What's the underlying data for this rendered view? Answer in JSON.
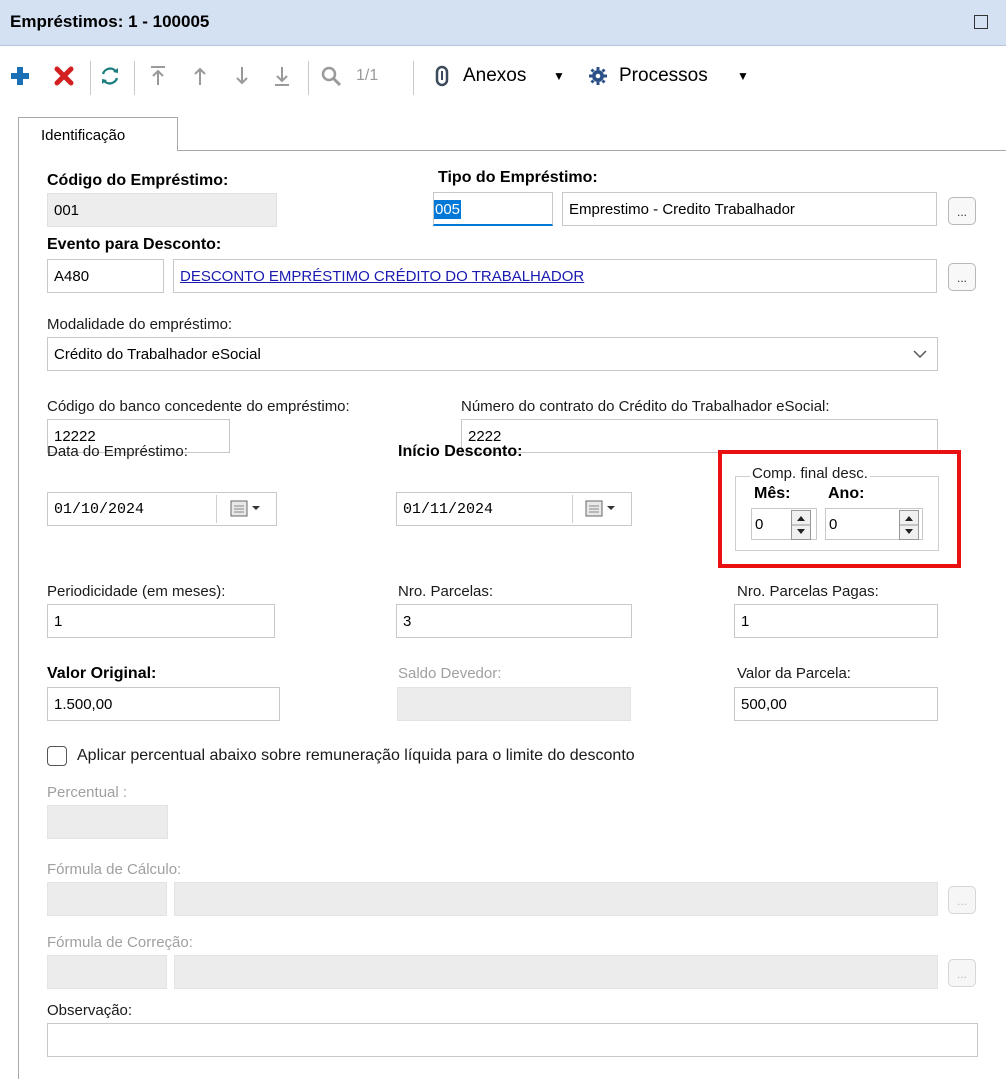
{
  "window": {
    "title": "Empréstimos: 1 - 100005"
  },
  "toolbar": {
    "page_indicator": "1/1",
    "anexos_label": "Anexos",
    "processos_label": "Processos"
  },
  "tabs": [
    {
      "label": "Identificação"
    }
  ],
  "form": {
    "codigo_emprestimo": {
      "label": "Código do Empréstimo:",
      "value": "001"
    },
    "tipo_emprestimo": {
      "label": "Tipo do Empréstimo:",
      "code": "005",
      "description": "Emprestimo - Credito Trabalhador"
    },
    "evento_desconto": {
      "label": "Evento para Desconto:",
      "code": "A480",
      "description": "DESCONTO EMPRÉSTIMO CRÉDITO DO TRABALHADOR"
    },
    "modalidade": {
      "label": "Modalidade do empréstimo:",
      "value": "Crédito do Trabalhador eSocial"
    },
    "codigo_banco": {
      "label": "Código do banco concedente do empréstimo:",
      "value": "12222"
    },
    "numero_contrato": {
      "label": "Número do contrato do Crédito do Trabalhador eSocial:",
      "value": "2222"
    },
    "data_emprestimo": {
      "label": "Data do Empréstimo:",
      "value": "01/10/2024"
    },
    "inicio_desconto": {
      "label": "Início Desconto:",
      "value": "01/11/2024"
    },
    "comp_final": {
      "label": "Comp. final desc.",
      "mes_label": "Mês:",
      "ano_label": "Ano:",
      "mes_value": "0",
      "ano_value": "0"
    },
    "periodicidade": {
      "label": "Periodicidade (em meses):",
      "value": "1"
    },
    "nro_parcelas": {
      "label": "Nro. Parcelas:",
      "value": "3"
    },
    "nro_parcelas_pagas": {
      "label": "Nro. Parcelas Pagas:",
      "value": "1"
    },
    "valor_original": {
      "label": "Valor Original:",
      "value": "1.500,00"
    },
    "saldo_devedor": {
      "label": "Saldo Devedor:",
      "value": ""
    },
    "valor_parcela": {
      "label": "Valor da Parcela:",
      "value": "500,00"
    },
    "aplicar_percentual": {
      "label": "Aplicar percentual abaixo sobre remuneração líquida para o limite do desconto"
    },
    "percentual": {
      "label": "Percentual :"
    },
    "formula_calculo": {
      "label": "Fórmula de Cálculo:"
    },
    "formula_correcao": {
      "label": "Fórmula de Correção:"
    },
    "observacao": {
      "label": "Observação:",
      "value": ""
    },
    "ellipsis": "..."
  },
  "colors": {
    "title_bar": "#d4e1f2",
    "add_icon": "#1a6fb5",
    "delete_icon": "#d32020",
    "highlight_box": "#e81010",
    "link_text": "#1a1ab0",
    "selection": "#0078d7"
  }
}
